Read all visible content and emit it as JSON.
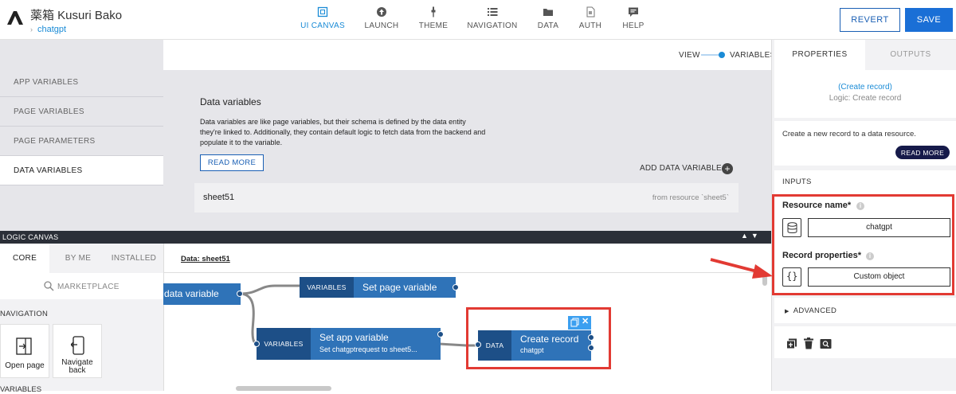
{
  "header": {
    "app_title": "薬箱 Kusuri Bako",
    "breadcrumb": "chatgpt",
    "tabs": [
      {
        "label": "UI CANVAS",
        "icon": "ui-canvas-icon",
        "active": true
      },
      {
        "label": "LAUNCH",
        "icon": "launch-icon"
      },
      {
        "label": "THEME",
        "icon": "theme-icon"
      },
      {
        "label": "NAVIGATION",
        "icon": "navigation-icon"
      },
      {
        "label": "DATA",
        "icon": "folder-icon"
      },
      {
        "label": "AUTH",
        "icon": "auth-icon"
      },
      {
        "label": "HELP",
        "icon": "help-icon"
      }
    ],
    "revert_label": "REVERT",
    "save_label": "SAVE",
    "accent_color": "#1a8bd6"
  },
  "variables_sidebar": {
    "items": [
      {
        "label": "APP VARIABLES"
      },
      {
        "label": "PAGE VARIABLES"
      },
      {
        "label": "PAGE PARAMETERS"
      },
      {
        "label": "DATA VARIABLES",
        "active": true
      }
    ]
  },
  "view_toggle": {
    "view_label": "VIEW",
    "variables_label": "VARIABLES"
  },
  "data_variables_panel": {
    "title": "Data variables",
    "description": "Data variables are like page variables, but their schema is defined by the data entity they're linked to. Additionally, they contain default logic to fetch data from the backend and populate it to the variable.",
    "read_more_label": "READ MORE",
    "add_label": "ADD DATA VARIABLE",
    "rows": [
      {
        "name": "sheet51",
        "source": "from resource `sheet5`"
      }
    ]
  },
  "logic_canvas": {
    "title": "LOGIC CANVAS",
    "tabs": [
      {
        "label": "CORE",
        "active": true
      },
      {
        "label": "BY ME"
      },
      {
        "label": "INSTALLED"
      }
    ],
    "marketplace_label": "MARKETPLACE",
    "navigation_section": "NAVIGATION",
    "cards": [
      {
        "label": "Open page",
        "icon": "open-page-icon"
      },
      {
        "label": "Navigate back",
        "icon": "navigate-back-icon"
      }
    ],
    "variables_section": "VARIABLES",
    "canvas_tab": "Data: sheet51",
    "nodes": {
      "data_variable": "data variable",
      "set_page_variable": {
        "tag": "VARIABLES",
        "title": "Set page variable"
      },
      "set_app_variable": {
        "tag": "VARIABLES",
        "title": "Set app variable",
        "subtitle": "Set chatgptrequest to sheet5..."
      },
      "create_record": {
        "tag": "DATA",
        "title": "Create record",
        "subtitle": "chatgpt"
      }
    }
  },
  "properties_panel": {
    "tabs": [
      {
        "label": "PROPERTIES",
        "active": true
      },
      {
        "label": "OUTPUTS"
      }
    ],
    "node_link": "(Create record)",
    "node_subtitle": "Logic: Create record",
    "description": "Create a new record to a data resource.",
    "read_more_label": "READ MORE",
    "inputs_label": "INPUTS",
    "resource_name_label": "Resource name*",
    "resource_name_value": "chatgpt",
    "record_properties_label": "Record properties*",
    "record_properties_value": "Custom object",
    "advanced_label": "ADVANCED",
    "highlight_color": "#e23a33"
  }
}
